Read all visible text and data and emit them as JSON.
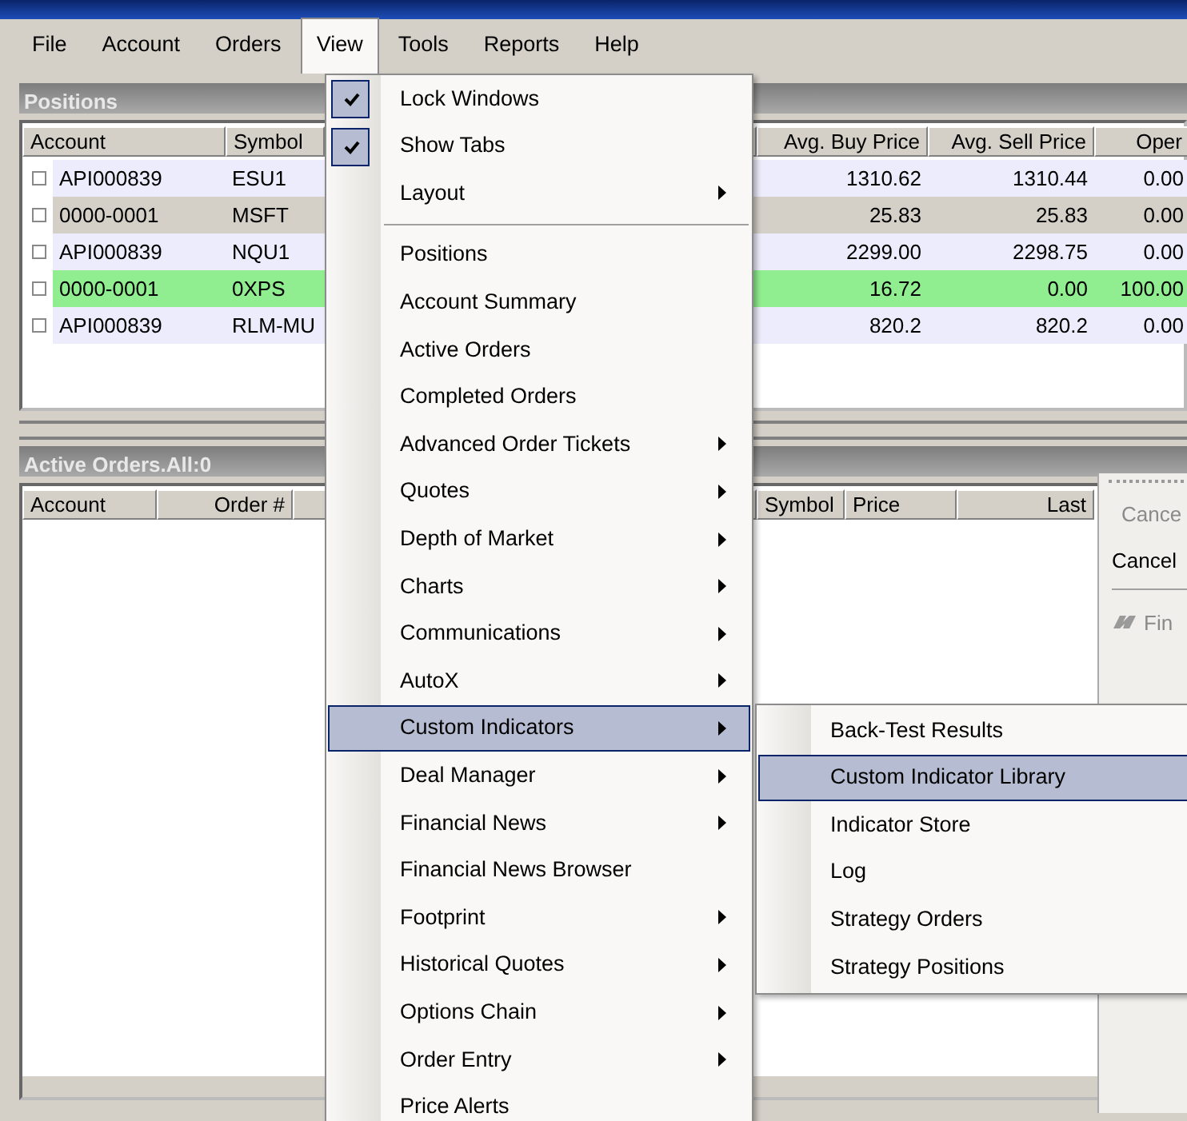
{
  "menu_bar": [
    {
      "label": "File",
      "selected": false
    },
    {
      "label": "Account",
      "selected": false
    },
    {
      "label": "Orders",
      "selected": false
    },
    {
      "label": "View",
      "selected": true
    },
    {
      "label": "Tools",
      "selected": false
    },
    {
      "label": "Reports",
      "selected": false
    },
    {
      "label": "Help",
      "selected": false
    }
  ],
  "positions": {
    "title": "Positions",
    "columns": [
      {
        "label": "Account",
        "kind": "text"
      },
      {
        "label": "Symbol",
        "kind": "text"
      },
      {
        "kind": "text"
      },
      {
        "label": "Avg. Buy Price",
        "kind": "number"
      },
      {
        "label": "Avg. Sell Price",
        "kind": "number"
      },
      {
        "label": "Oper",
        "kind": "number"
      }
    ],
    "rows": [
      {
        "color": "#ececfc",
        "cells": [
          "API000839",
          "ESU1",
          "",
          "1310.62",
          "1310.44",
          "0.00"
        ]
      },
      {
        "color": "#d4d0c8",
        "cells": [
          "0000-0001",
          "MSFT",
          "",
          "25.83",
          "25.83",
          "0.00"
        ]
      },
      {
        "color": "#ececfc",
        "cells": [
          "API000839",
          "NQU1",
          "",
          "2299.00",
          "2298.75",
          "0.00"
        ]
      },
      {
        "color": "#90ee90",
        "cells": [
          "0000-0001",
          "0XPS",
          "",
          "16.72",
          "0.00",
          "100.00"
        ]
      },
      {
        "color": "#ececfc",
        "cells": [
          "API000839",
          "RLM-MU",
          "",
          "820.2",
          "820.2",
          "0.00"
        ]
      }
    ]
  },
  "active_orders": {
    "title": "Active Orders.All:0",
    "columns": [
      {
        "label": "Account",
        "kind": "text"
      },
      {
        "label": "Order #",
        "kind": "number"
      },
      {
        "kind": "text"
      },
      {
        "label": "Symbol",
        "kind": "text"
      },
      {
        "label": "Price",
        "kind": "text"
      },
      {
        "label": "Last",
        "kind": "number"
      }
    ]
  },
  "side_toolbar": [
    {
      "label": "Cance",
      "disabled": true,
      "kind": "text"
    },
    {
      "label": "Cancel",
      "disabled": false,
      "kind": "text"
    },
    {
      "kind": "separator"
    },
    {
      "label": "Fin",
      "disabled": true,
      "kind": "find"
    }
  ],
  "view_menu": [
    {
      "kind": "check",
      "label": "Lock Windows",
      "checked": true,
      "selected": false
    },
    {
      "kind": "check",
      "label": "Show Tabs",
      "checked": true,
      "selected": false
    },
    {
      "kind": "submenu",
      "label": "Layout",
      "selected": false
    },
    {
      "kind": "separator"
    },
    {
      "kind": "plain",
      "label": "Positions",
      "selected": false
    },
    {
      "kind": "plain",
      "label": "Account Summary",
      "selected": false
    },
    {
      "kind": "plain",
      "label": "Active Orders",
      "selected": false
    },
    {
      "kind": "plain",
      "label": "Completed Orders",
      "selected": false
    },
    {
      "kind": "submenu",
      "label": "Advanced Order Tickets",
      "selected": false
    },
    {
      "kind": "submenu",
      "label": "Quotes",
      "selected": false
    },
    {
      "kind": "submenu",
      "label": "Depth of Market",
      "selected": false
    },
    {
      "kind": "submenu",
      "label": "Charts",
      "selected": false
    },
    {
      "kind": "submenu",
      "label": "Communications",
      "selected": false
    },
    {
      "kind": "submenu",
      "label": "AutoX",
      "selected": false
    },
    {
      "kind": "submenu",
      "label": "Custom Indicators",
      "selected": true
    },
    {
      "kind": "submenu",
      "label": "Deal Manager",
      "selected": false
    },
    {
      "kind": "submenu",
      "label": "Financial News",
      "selected": false
    },
    {
      "kind": "plain",
      "label": "Financial News Browser",
      "selected": false
    },
    {
      "kind": "submenu",
      "label": "Footprint",
      "selected": false
    },
    {
      "kind": "submenu",
      "label": "Historical Quotes",
      "selected": false
    },
    {
      "kind": "submenu",
      "label": "Options Chain",
      "selected": false
    },
    {
      "kind": "submenu",
      "label": "Order Entry",
      "selected": false
    },
    {
      "kind": "plain",
      "label": "Price Alerts",
      "selected": false
    }
  ],
  "custom_indicators_menu": [
    {
      "label": "Back-Test Results",
      "selected": false
    },
    {
      "label": "Custom Indicator Library",
      "selected": true
    },
    {
      "label": "Indicator Store",
      "selected": false
    },
    {
      "label": "Log",
      "selected": false
    },
    {
      "label": "Strategy Orders",
      "selected": false
    },
    {
      "label": "Strategy Positions",
      "selected": false
    }
  ]
}
